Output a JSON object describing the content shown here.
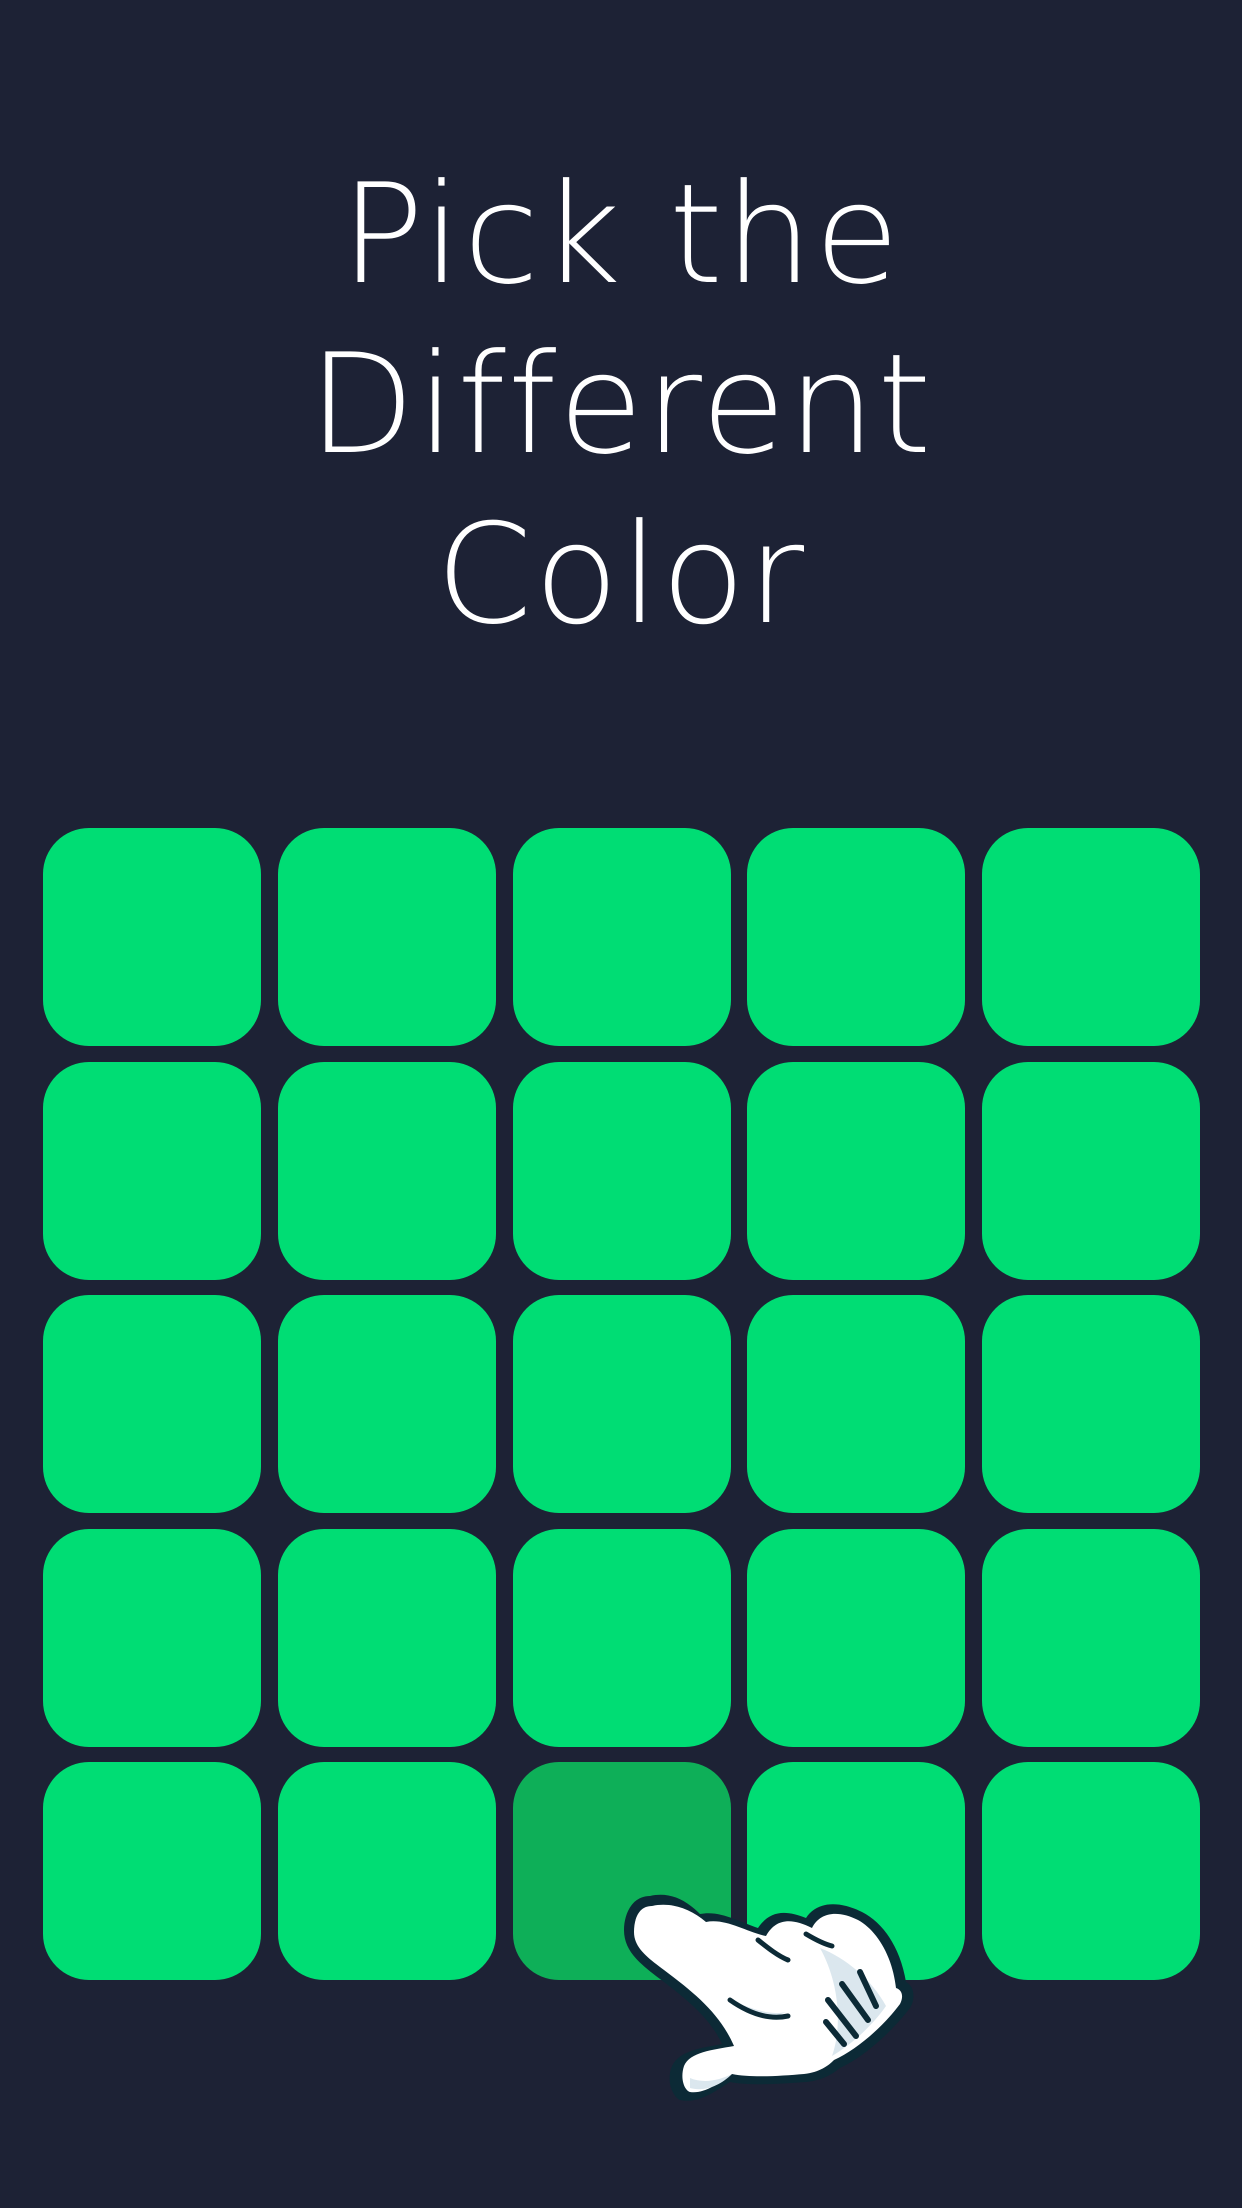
{
  "title": {
    "lines": [
      "Pick the",
      "Different",
      "Color"
    ]
  },
  "board": {
    "rows": 5,
    "columns": 5,
    "base_color": "#00dd74",
    "odd_color": "#0eaf58",
    "odd_tile": {
      "row": 5,
      "column": 3
    }
  },
  "colors": {
    "background": "#1d2235",
    "text": "#ffffff"
  },
  "hint": {
    "icon": "pointing-hand-icon"
  }
}
